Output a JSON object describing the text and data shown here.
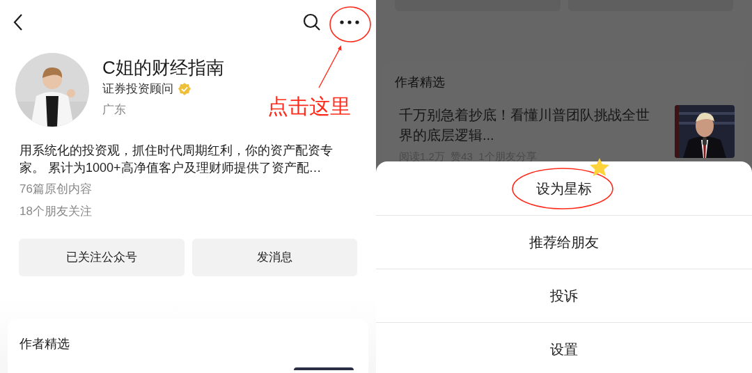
{
  "left_screen": {
    "profile": {
      "name": "C姐的财经指南",
      "title": "证券投资顾问",
      "verified": true,
      "region": "广东",
      "bio": "用系统化的投资观，抓住时代周期红利，你的资产配资专家。 累计为1000+高净值客户及理财师提供了资产配…",
      "original_count": "76篇原创内容",
      "friends_following": "18个朋友关注"
    },
    "buttons": [
      "已关注公众号",
      "发消息"
    ],
    "section_title": "作者精选"
  },
  "annotation": {
    "text": "点击这里"
  },
  "right_screen": {
    "section_title": "作者精选",
    "article": {
      "title": "千万别急着抄底！看懂川普团队挑战全世界的底层逻辑...",
      "stats": "阅读1.2万  赞43  1个朋友分享"
    },
    "action_sheet": [
      {
        "label": "设为星标",
        "highlighted": true
      },
      {
        "label": "推荐给朋友",
        "highlighted": false
      },
      {
        "label": "投诉",
        "highlighted": false
      },
      {
        "label": "设置",
        "highlighted": false
      }
    ]
  }
}
